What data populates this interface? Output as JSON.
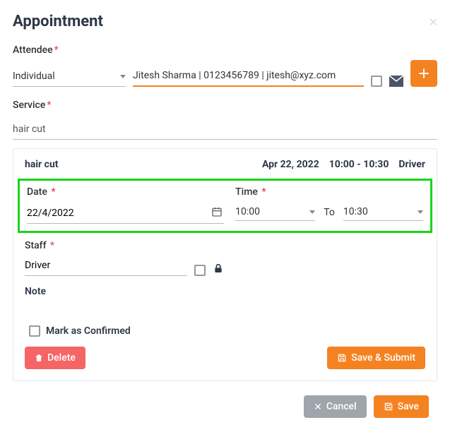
{
  "title": "Appointment",
  "attendee": {
    "label": "Attendee",
    "type": "Individual",
    "value": "Jitesh Sharma | 0123456789 | jitesh@xyz.com"
  },
  "service": {
    "label": "Service",
    "value": "hair cut"
  },
  "card": {
    "service_name": "hair cut",
    "date_display": "Apr 22, 2022",
    "time_range": "10:00 - 10:30",
    "staff_display": "Driver",
    "date": {
      "label": "Date",
      "value": "22/4/2022"
    },
    "time": {
      "label": "Time",
      "from": "10:00",
      "to_label": "To",
      "to": "10:30"
    },
    "staff": {
      "label": "Staff",
      "value": "Driver"
    },
    "note_label": "Note",
    "confirm_label": "Mark as Confirmed",
    "delete_label": "Delete",
    "save_submit_label": "Save & Submit"
  },
  "footer": {
    "cancel_label": "Cancel",
    "save_label": "Save"
  }
}
